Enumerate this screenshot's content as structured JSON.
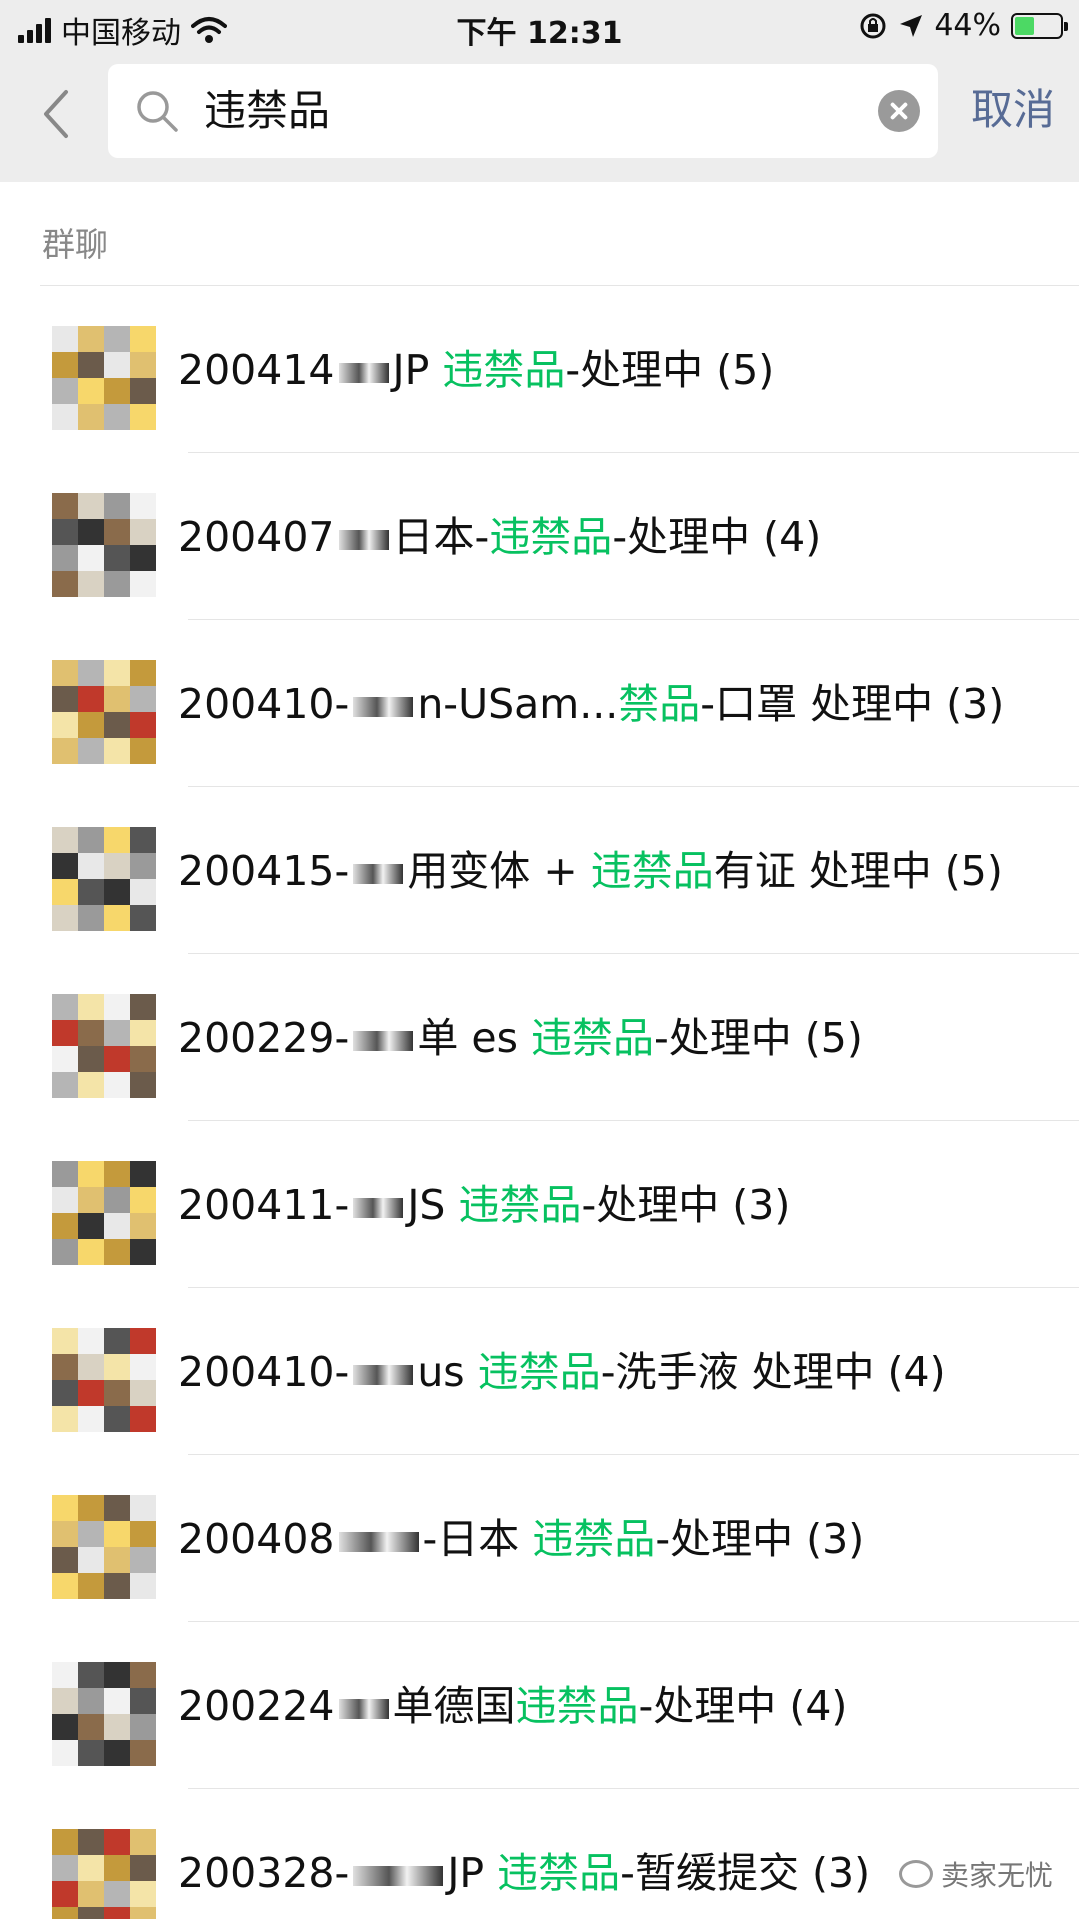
{
  "status_bar": {
    "carrier": "中国移动",
    "time": "下午 12:31",
    "battery": "44%"
  },
  "search": {
    "query": "违禁品",
    "cancel_label": "取消"
  },
  "section": {
    "title": "群聊"
  },
  "results": [
    {
      "prefix": "200414",
      "mid": "JP ",
      "highlight": "违禁品",
      "suffix": "-处理中 (5)"
    },
    {
      "prefix": "200407",
      "mid": "日本-",
      "highlight": "违禁品",
      "suffix": "-处理中 (4)"
    },
    {
      "prefix": "200410-",
      "mid": "n-USam...",
      "highlight": "禁品",
      "suffix": "-口罩 处理中 (3)"
    },
    {
      "prefix": "200415-",
      "mid": "用变体 + ",
      "highlight": "违禁品",
      "suffix": "有证 处理中 (5)"
    },
    {
      "prefix": "200229-",
      "mid": "单 es ",
      "highlight": "违禁品",
      "suffix": "-处理中 (5)"
    },
    {
      "prefix": "200411-",
      "mid": "JS ",
      "highlight": "违禁品",
      "suffix": "-处理中 (3)"
    },
    {
      "prefix": "200410-",
      "mid": "us ",
      "highlight": "违禁品",
      "suffix": "-洗手液 处理中 (4)"
    },
    {
      "prefix": "200408",
      "mid": "-日本 ",
      "highlight": "违禁品",
      "suffix": "-处理中 (3)"
    },
    {
      "prefix": "200224",
      "mid": "单德国",
      "highlight": "违禁品",
      "suffix": "-处理中 (4)"
    },
    {
      "prefix": "200328-",
      "mid": "JP ",
      "highlight": "违禁品",
      "suffix": "-暂缓提交 (3)"
    }
  ],
  "watermark": "卖家无忧",
  "colors": {
    "highlight": "#07c160",
    "link": "#576b95",
    "bar_background": "#ededed"
  },
  "icons": [
    "signal-icon",
    "wifi-icon",
    "lock-rotation-icon",
    "location-icon",
    "battery-icon",
    "back-chevron-icon",
    "search-icon",
    "clear-icon"
  ]
}
